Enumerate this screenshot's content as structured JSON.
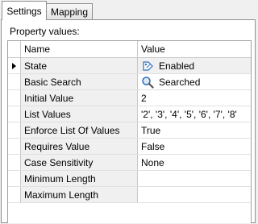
{
  "tabs": [
    {
      "label": "Settings",
      "active": true
    },
    {
      "label": "Mapping",
      "active": false
    }
  ],
  "section_label": "Property values:",
  "grid": {
    "columns": {
      "name": "Name",
      "value": "Value"
    },
    "rows": [
      {
        "name": "State",
        "value": "Enabled",
        "icon": "enabled-state-icon",
        "selected": true
      },
      {
        "name": "Basic Search",
        "value": "Searched",
        "icon": "magnifier-icon",
        "selected": false
      },
      {
        "name": "Initial Value",
        "value": "2"
      },
      {
        "name": "List Values",
        "value": "'2', '3', '4', '5', '6', '7', '8'"
      },
      {
        "name": "Enforce List Of Values",
        "value": "True"
      },
      {
        "name": "Requires Value",
        "value": "False"
      },
      {
        "name": "Case Sensitivity",
        "value": "None"
      },
      {
        "name": "Minimum Length",
        "value": ""
      },
      {
        "name": "Maximum Length",
        "value": ""
      }
    ]
  },
  "colors": {
    "border": "#8e8f8f",
    "name_cell_bg": "#f0f0f0",
    "icon_blue": "#2c6cb8"
  }
}
